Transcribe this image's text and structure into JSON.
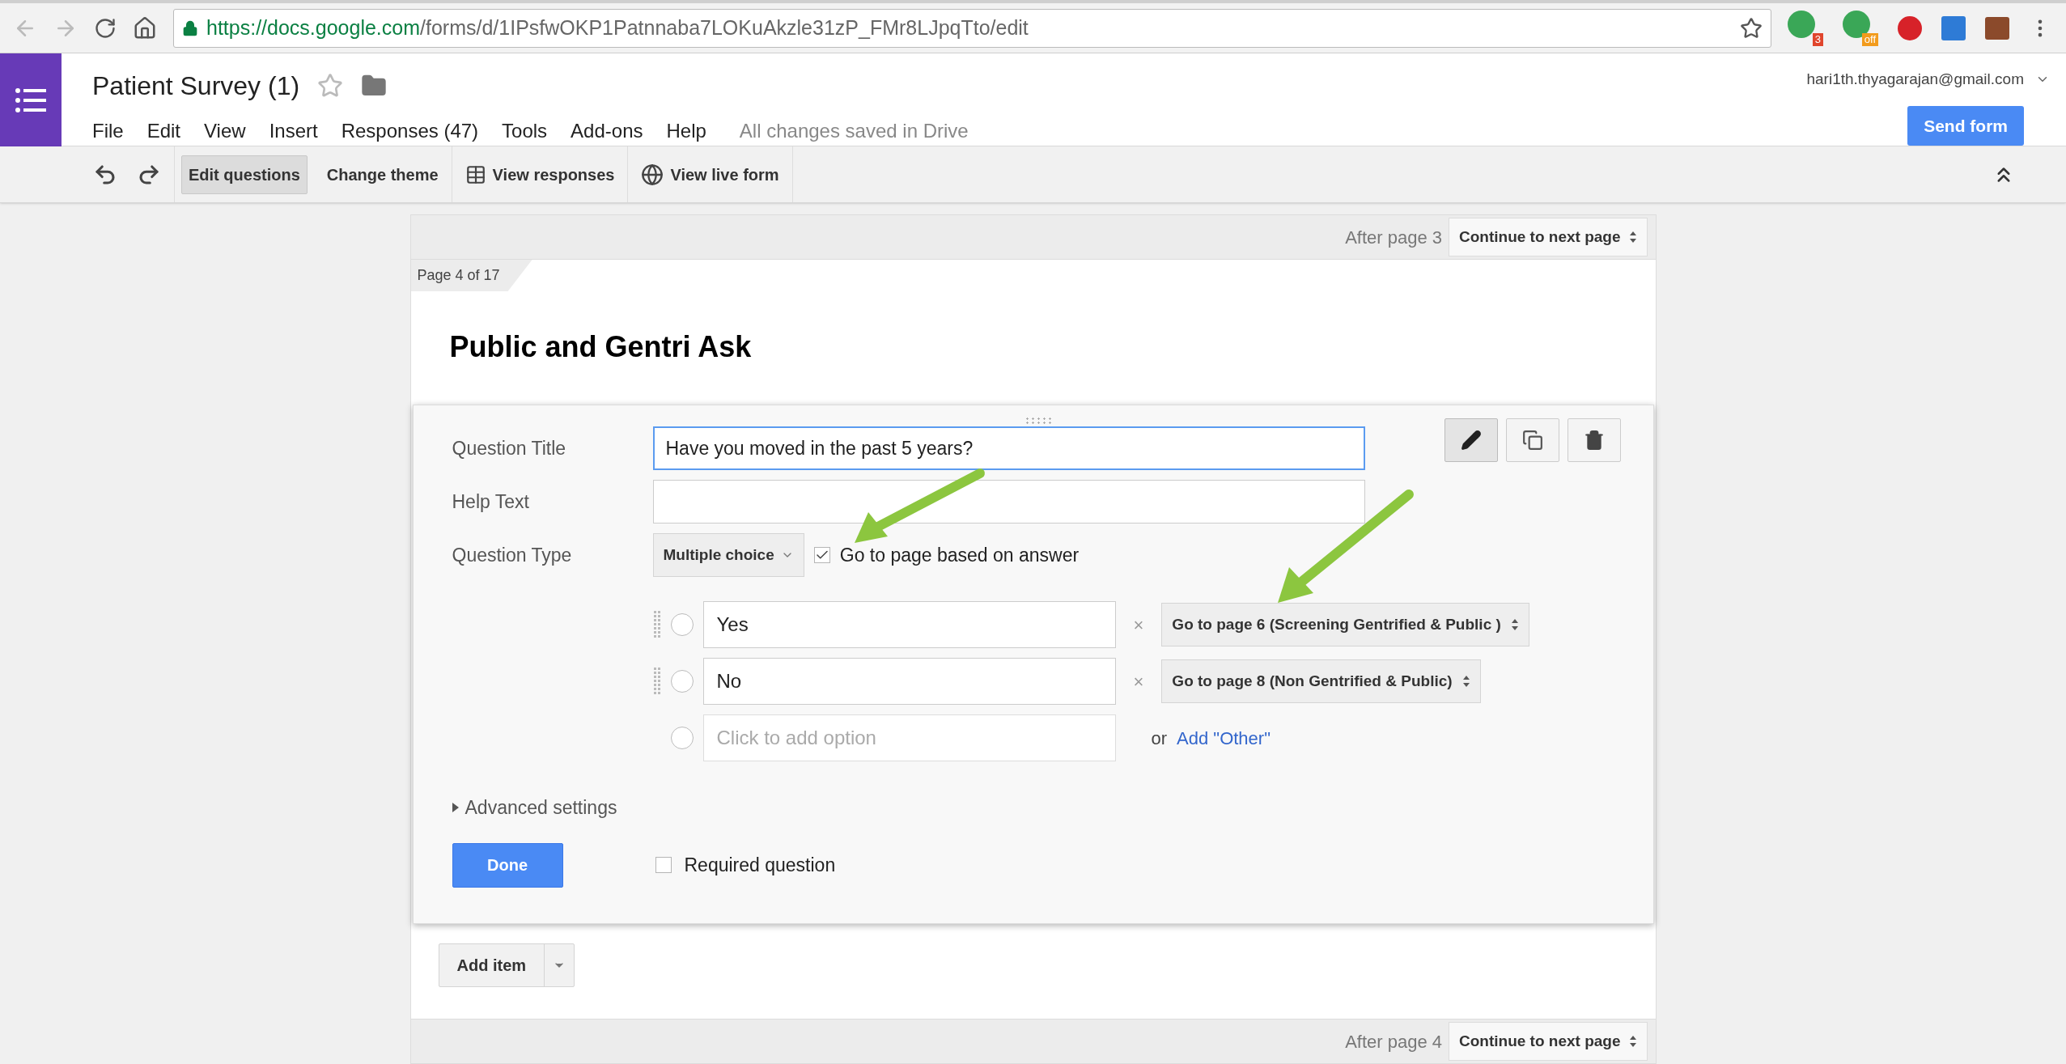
{
  "browser": {
    "url_host": "https://docs.google.com",
    "url_path": "/forms/d/1IPsfwOKP1Patnnaba7LOKuAkzle31zP_FMr8LJpqTto/edit",
    "extension_badges": [
      "3",
      "off"
    ]
  },
  "header": {
    "title": "Patient Survey (1)",
    "account": "hari1th.thyagarajan@gmail.com",
    "send_button": "Send form",
    "save_status": "All changes saved in Drive"
  },
  "menu": [
    "File",
    "Edit",
    "View",
    "Insert",
    "Responses (47)",
    "Tools",
    "Add-ons",
    "Help"
  ],
  "toolbar": [
    {
      "label": "Edit questions",
      "selected": true,
      "kind": "plain"
    },
    {
      "label": "Change theme",
      "selected": false,
      "kind": "plain"
    },
    {
      "label": "View responses",
      "selected": false,
      "kind": "table"
    },
    {
      "label": "View live form",
      "selected": false,
      "kind": "globe"
    }
  ],
  "top_navigation": {
    "label": "After page 3",
    "select": "Continue to next page"
  },
  "page": {
    "tab": "Page 4 of 17",
    "title": "Public and Gentri Ask"
  },
  "question": {
    "title_label": "Question Title",
    "title_value": "Have you moved in the past 5 years?",
    "help_label": "Help Text",
    "type_label": "Question Type",
    "type_value": "Multiple choice",
    "go_to_page": {
      "label": "Go to page based on answer",
      "checked": true
    },
    "options": [
      {
        "value": "Yes",
        "remove": "×",
        "target": "Go to page 6 (Screening Gentrified & Public )"
      },
      {
        "value": "No",
        "remove": "×",
        "target": "Go to page 8 (Non Gentrified & Public)"
      }
    ],
    "add_option_placeholder": "Click to add option",
    "or_text": "or",
    "add_other": "Add \"Other\"",
    "advanced": "Advanced settings",
    "done": "Done",
    "required": {
      "label": "Required question",
      "checked": false
    }
  },
  "add_item": "Add item",
  "bottom_navigation": {
    "label": "After page 4",
    "select": "Continue to next page"
  }
}
